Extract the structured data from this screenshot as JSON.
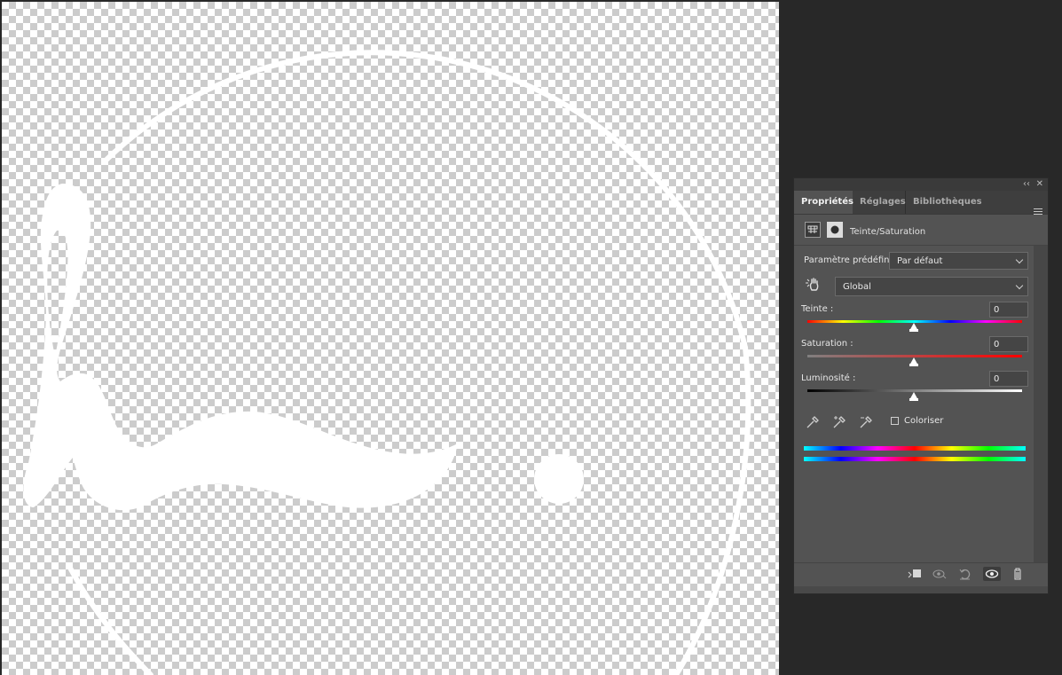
{
  "panel": {
    "topbar": {
      "collapse_glyph": "‹‹",
      "close_glyph": "✕"
    },
    "tabs": [
      {
        "label": "Propriétés",
        "active": true
      },
      {
        "label": "Réglages",
        "active": false
      },
      {
        "label": "Bibliothèques",
        "active": false
      }
    ],
    "adjustment_title": "Teinte/Saturation",
    "preset_label": "Paramètre prédéfini :",
    "preset_value": "Par défaut",
    "channel_value": "Global",
    "hue": {
      "label": "Teinte :",
      "value": "0"
    },
    "saturation": {
      "label": "Saturation :",
      "value": "0"
    },
    "lightness": {
      "label": "Luminosité :",
      "value": "0"
    },
    "colorize_label": "Coloriser",
    "colorize_checked": false
  },
  "icons": [
    "hue-sat-adjustment-icon",
    "layer-mask-icon",
    "targeted-adjustment-hand-icon",
    "eyedropper-icon",
    "eyedropper-plus-icon",
    "eyedropper-minus-icon",
    "clip-to-layer-icon",
    "view-previous-state-icon",
    "reset-icon",
    "visibility-eye-icon",
    "trash-icon",
    "panel-menu-icon"
  ],
  "colors": {
    "app_bg": "#282828",
    "panel_bg": "#535353",
    "tab_bar_bg": "#3e3e3e",
    "canvas_artwork": "#ffffff"
  }
}
